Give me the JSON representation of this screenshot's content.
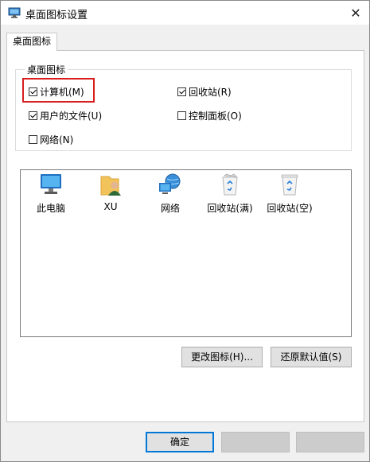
{
  "window": {
    "title": "桌面图标设置"
  },
  "tab": {
    "label": "桌面图标"
  },
  "group": {
    "legend": "桌面图标"
  },
  "checkboxes": [
    {
      "label": "计算机(M)",
      "checked": true
    },
    {
      "label": "回收站(R)",
      "checked": true
    },
    {
      "label": "用户的文件(U)",
      "checked": true
    },
    {
      "label": "控制面板(O)",
      "checked": false
    },
    {
      "label": "网络(N)",
      "checked": false
    }
  ],
  "icons": [
    {
      "label": "此电脑",
      "icon": "computer-icon"
    },
    {
      "label": "XU",
      "icon": "user-folder-icon"
    },
    {
      "label": "网络",
      "icon": "network-icon"
    },
    {
      "label": "回收站(满)",
      "icon": "recycle-bin-full-icon"
    },
    {
      "label": "回收站(空)",
      "icon": "recycle-bin-empty-icon"
    }
  ],
  "buttons": {
    "change_icon": "更改图标(H)...",
    "restore_default": "还原默认值(S)",
    "ok": "确定",
    "cancel": "",
    "apply": ""
  },
  "colors": {
    "highlight": "#d81e1e",
    "focus": "#0078d7"
  }
}
